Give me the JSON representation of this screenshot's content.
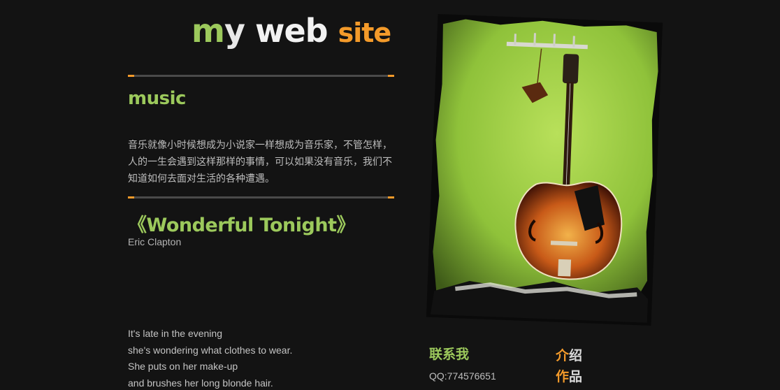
{
  "logo": {
    "part1a": "m",
    "part1b": "y",
    "part2": " web ",
    "part3": "site"
  },
  "section": {
    "title": "music",
    "intro_lines": [
      "音乐就像小时候想成为小说家一样想成为音乐家，不管怎样，",
      "人的一生会遇到这样那样的事情，可以如果没有音乐，我们不",
      "知道如何去面对生活的各种遭遇。"
    ]
  },
  "song": {
    "title": "《Wonderful Tonight》",
    "artist": "Eric Clapton",
    "lyrics": [
      "It's late in the evening",
      "she's wondering what clothes to wear.",
      "She puts on her make-up",
      "and brushes her long blonde hair."
    ]
  },
  "contact": {
    "title": "联系我",
    "qq": "QQ:774576651"
  },
  "nav": {
    "intro_first": "介",
    "intro_rest": "绍",
    "works_first": "作",
    "works_rest": "品"
  },
  "colors": {
    "background": "#131313",
    "accent_green": "#9cc95c",
    "accent_orange": "#f39a2a"
  },
  "icons": [
    "guitar-photo"
  ]
}
